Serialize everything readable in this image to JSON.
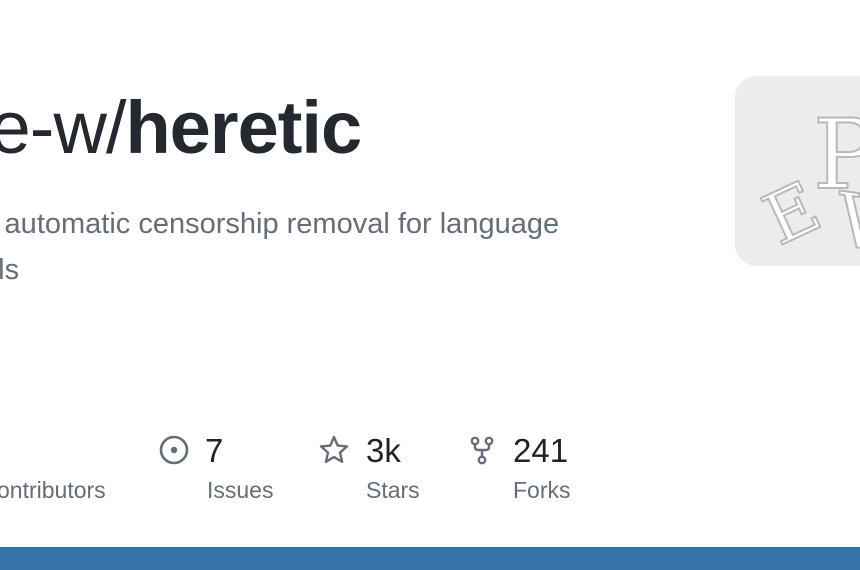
{
  "repo": {
    "owner_visible": "-e-w/",
    "name": "heretic",
    "description": "y automatic censorship removal for language els"
  },
  "description_lines": [
    "y automatic censorship removal for language",
    "els"
  ],
  "stats": [
    {
      "value": "",
      "label": "ontributors",
      "icon": "contributors-icon"
    },
    {
      "value": "7",
      "label": "Issues",
      "icon": "issue-opened-icon"
    },
    {
      "value": "3k",
      "label": "Stars",
      "icon": "star-icon"
    },
    {
      "value": "241",
      "label": "Forks",
      "icon": "repo-forked-icon"
    }
  ],
  "avatar": {
    "letters": [
      "P",
      "E",
      "V"
    ]
  },
  "colors": {
    "language_bar": "#3572a5",
    "title": "#24292f",
    "muted": "#656d76",
    "avatar_bg": "#ececee"
  }
}
